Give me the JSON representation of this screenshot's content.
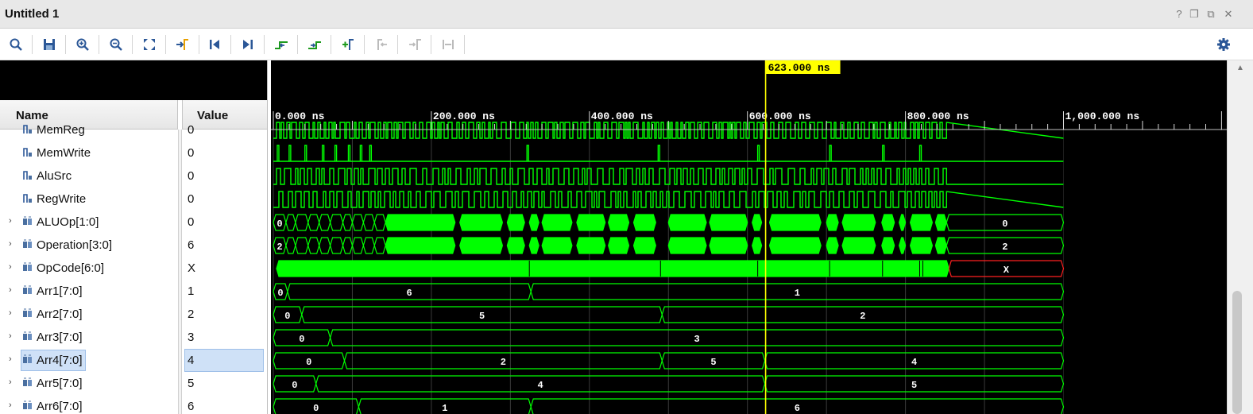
{
  "window": {
    "title": "Untitled 1",
    "buttons": [
      {
        "name": "help-button",
        "glyph": "?"
      },
      {
        "name": "restore-button",
        "glyph": "❐"
      },
      {
        "name": "maximize-button",
        "glyph": "⧉"
      },
      {
        "name": "close-button",
        "glyph": "✕"
      }
    ]
  },
  "toolbar": {
    "buttons": [
      {
        "name": "search-button",
        "icon": "search-icon",
        "enabled": true
      },
      {
        "name": "save-button",
        "icon": "save-icon",
        "enabled": true
      },
      {
        "name": "zoom-in-button",
        "icon": "zoom-in-icon",
        "enabled": true
      },
      {
        "name": "zoom-out-button",
        "icon": "zoom-out-icon",
        "enabled": true
      },
      {
        "name": "zoom-fit-button",
        "icon": "zoom-fit-icon",
        "enabled": true
      },
      {
        "name": "go-to-cursor-button",
        "icon": "go-to-cursor-icon",
        "enabled": true
      },
      {
        "name": "go-to-time-zero-button",
        "icon": "go-to-start-icon",
        "enabled": true
      },
      {
        "name": "go-to-last-time-button",
        "icon": "go-to-end-icon",
        "enabled": true
      },
      {
        "name": "previous-transition-button",
        "icon": "previous-transition-icon",
        "enabled": true
      },
      {
        "name": "next-transition-button",
        "icon": "next-transition-icon",
        "enabled": true
      },
      {
        "name": "add-marker-button",
        "icon": "add-marker-icon",
        "enabled": true
      },
      {
        "name": "previous-marker-button",
        "icon": "previous-marker-icon",
        "enabled": false
      },
      {
        "name": "next-marker-button",
        "icon": "next-marker-icon",
        "enabled": false
      },
      {
        "name": "swap-cursors-button",
        "icon": "swap-cursors-icon",
        "enabled": false
      }
    ],
    "settings_icon": "gear-icon"
  },
  "columns": {
    "name": "Name",
    "value": "Value"
  },
  "signals": [
    {
      "name": "MemReg",
      "value": "0",
      "type": "bit",
      "wave": "mixed-bit"
    },
    {
      "name": "MemWrite",
      "value": "0",
      "type": "bit",
      "wave": "sparse-pulses"
    },
    {
      "name": "AluSrc",
      "value": "0",
      "type": "bit",
      "wave": "dense-bit"
    },
    {
      "name": "RegWrite",
      "value": "0",
      "type": "bit",
      "wave": "dense-bit"
    },
    {
      "name": "ALUOp[1:0]",
      "value": "0",
      "type": "bus",
      "wave": "dense-bus",
      "start_label": "0",
      "end_label": "0"
    },
    {
      "name": "Operation[3:0]",
      "value": "6",
      "type": "bus",
      "wave": "dense-bus",
      "start_label": "2",
      "end_label": "2"
    },
    {
      "name": "OpCode[6:0]",
      "value": "X",
      "type": "bus",
      "wave": "opcode",
      "end_label": "X"
    },
    {
      "name": "Arr1[7:0]",
      "value": "1",
      "type": "bus",
      "wave": "segments",
      "segments": [
        {
          "label": "0",
          "from_ns": 0,
          "to_ns": 18
        },
        {
          "label": "6",
          "from_ns": 18,
          "to_ns": 326
        },
        {
          "label": "1",
          "from_ns": 326,
          "to_ns": 1000
        }
      ]
    },
    {
      "name": "Arr2[7:0]",
      "value": "2",
      "type": "bus",
      "wave": "segments",
      "segments": [
        {
          "label": "0",
          "from_ns": 0,
          "to_ns": 36
        },
        {
          "label": "5",
          "from_ns": 36,
          "to_ns": 492
        },
        {
          "label": "2",
          "from_ns": 492,
          "to_ns": 1000
        }
      ]
    },
    {
      "name": "Arr3[7:0]",
      "value": "3",
      "type": "bus",
      "wave": "segments",
      "segments": [
        {
          "label": "0",
          "from_ns": 0,
          "to_ns": 72
        },
        {
          "label": "3",
          "from_ns": 72,
          "to_ns": 1000
        }
      ]
    },
    {
      "name": "Arr4[7:0]",
      "value": "4",
      "type": "bus",
      "wave": "segments",
      "selected": true,
      "segments": [
        {
          "label": "0",
          "from_ns": 0,
          "to_ns": 90
        },
        {
          "label": "2",
          "from_ns": 90,
          "to_ns": 492
        },
        {
          "label": "5",
          "from_ns": 492,
          "to_ns": 622
        },
        {
          "label": "4",
          "from_ns": 622,
          "to_ns": 1000
        }
      ]
    },
    {
      "name": "Arr5[7:0]",
      "value": "5",
      "type": "bus",
      "wave": "segments",
      "segments": [
        {
          "label": "0",
          "from_ns": 0,
          "to_ns": 54
        },
        {
          "label": "4",
          "from_ns": 54,
          "to_ns": 622
        },
        {
          "label": "5",
          "from_ns": 622,
          "to_ns": 1000
        }
      ]
    },
    {
      "name": "Arr6[7:0]",
      "value": "6",
      "type": "bus",
      "wave": "segments",
      "segments": [
        {
          "label": "0",
          "from_ns": 0,
          "to_ns": 108
        },
        {
          "label": "1",
          "from_ns": 108,
          "to_ns": 326
        },
        {
          "label": "6",
          "from_ns": 326,
          "to_ns": 1000
        }
      ]
    }
  ],
  "timeline": {
    "ticks": [
      {
        "ns": 0,
        "label": "0.000 ns"
      },
      {
        "ns": 200,
        "label": "200.000 ns"
      },
      {
        "ns": 400,
        "label": "400.000 ns"
      },
      {
        "ns": 600,
        "label": "600.000 ns"
      },
      {
        "ns": 800,
        "label": "800.000 ns"
      },
      {
        "ns": 1000,
        "label": "1,000.000 ns"
      }
    ],
    "cursor_ns": 623,
    "cursor_label": "623.000 ns",
    "sim_end_ns": 1000,
    "active_end_ns": 852
  },
  "colors": {
    "wave": "#00ff00",
    "background": "#000000",
    "cursor": "#ffff00",
    "cursor_label_bg": "#ffff00",
    "unknown": "#ff2020",
    "grid": "#3a3a3a",
    "selection": "#cfe1f7"
  }
}
